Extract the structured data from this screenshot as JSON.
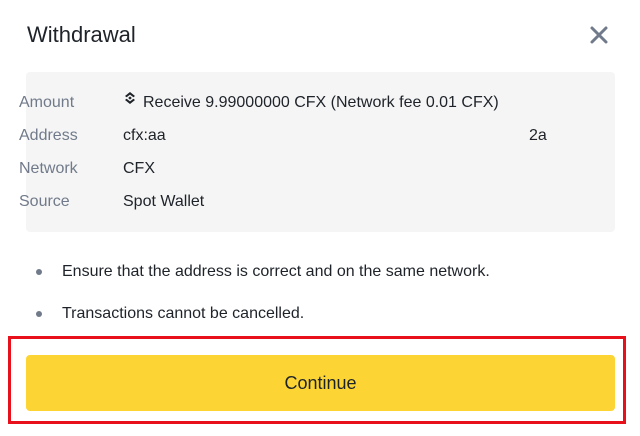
{
  "dialog": {
    "title": "Withdrawal",
    "close_icon": "close-icon"
  },
  "details": {
    "amount": {
      "label": "Amount",
      "icon": "cfx-token-icon",
      "value": "Receive 9.99000000 CFX (Network fee 0.01 CFX)"
    },
    "address": {
      "label": "Address",
      "value_start": "cfx:aa",
      "value_end": "2a"
    },
    "network": {
      "label": "Network",
      "value": "CFX"
    },
    "source": {
      "label": "Source",
      "value": "Spot Wallet"
    }
  },
  "notes": [
    "Ensure that the address is correct and on the same network.",
    "Transactions cannot be cancelled."
  ],
  "actions": {
    "continue_label": "Continue"
  },
  "colors": {
    "primary_button": "#fcd535",
    "highlight_border": "#e8101b",
    "label_text": "#707a8a",
    "panel_bg": "#f5f5f5"
  }
}
